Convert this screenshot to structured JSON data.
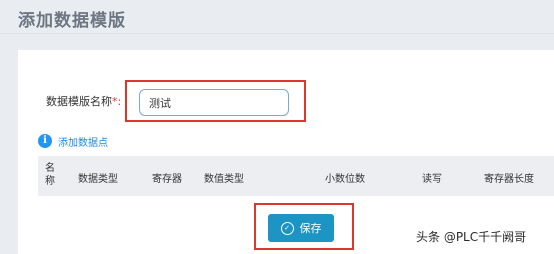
{
  "page": {
    "title": "添加数据模版"
  },
  "form": {
    "name_label": "数据模版名称",
    "required_mark": "*:",
    "name_value": "测试"
  },
  "add_point": {
    "icon": "info-icon",
    "icon_glyph": "i",
    "label": "添加数据点"
  },
  "table": {
    "headers": [
      "名称",
      "数据类型",
      "寄存器",
      "数值类型",
      "小数位数",
      "读写",
      "寄存器长度"
    ]
  },
  "save": {
    "icon": "check-circle-icon",
    "icon_glyph": "✓",
    "label": "保存"
  },
  "watermark": {
    "text": "头条 @PLC千千阙哥"
  },
  "colors": {
    "accent": "#1c94c4",
    "highlight_border": "#d9382b",
    "link": "#1e88e5"
  }
}
